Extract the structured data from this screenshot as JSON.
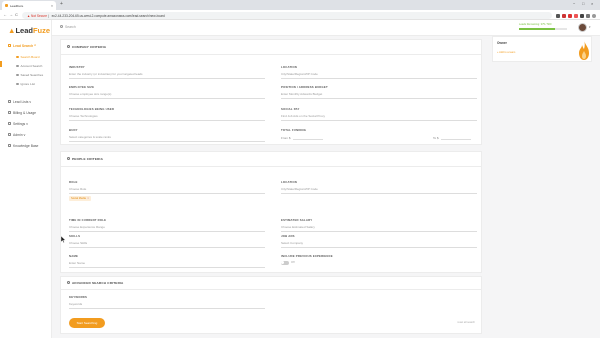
{
  "browser": {
    "tab_title": "LeadFuze",
    "new_tab": "+",
    "not_secure": "Not Secure",
    "url": "ec2-44-233-204-65.us-west-2.compute.amazonaws.com/lead-search/new-board",
    "nav": {
      "back": "←",
      "forward": "→",
      "reload": "C"
    },
    "window_controls": {
      "minimize": "−",
      "maximize": "□",
      "close": "×"
    }
  },
  "sidebar": {
    "logo": {
      "prefix": "Lead",
      "suffix": "Fuze"
    },
    "items": [
      {
        "label": "Lead Search",
        "caret": "^",
        "active": true
      },
      {
        "label": "Lead Lists",
        "caret": "v"
      },
      {
        "label": "Billing & Usage"
      },
      {
        "label": "Settings",
        "caret": "v"
      },
      {
        "label": "Admin",
        "caret": "v"
      },
      {
        "label": "Knowledge Base"
      }
    ],
    "sub_items": [
      {
        "label": "Search Board",
        "active": true
      },
      {
        "label": "Account Search"
      },
      {
        "label": "Saved Searches"
      },
      {
        "label": "Ignore List"
      }
    ]
  },
  "header": {
    "search_placeholder": "Search",
    "credits_label": "Leads Remaining: 375 / 500",
    "credits_fraction": 0.75
  },
  "company_card": {
    "title": "COMPANY CRITERIA",
    "fields": [
      {
        "label": "INDUSTRY",
        "placeholder": "Enter the industry (or industries) for your targeted leads"
      },
      {
        "label": "LOCATION",
        "placeholder": "City/State/Region/ZIP Code"
      },
      {
        "label": "EMPLOYEE SIZE",
        "placeholder": "Choose employee size range(s)"
      },
      {
        "label": "POSITION / ADDRESS BUDGET",
        "placeholder": "Enter Monthly Adwords Budget"
      },
      {
        "label": "TECHNOLOGIES BEING USED",
        "placeholder": "Choose Technologies"
      },
      {
        "label": "SOCIAL PAY",
        "placeholder": "Find Job Ads on the Social Proxy"
      },
      {
        "label": "BUDY",
        "placeholder": "Select categories & scale ranks"
      },
      {
        "label": "TOTAL FUNDING",
        "placeholder": ""
      }
    ],
    "funding_from": "From $",
    "funding_to": "To $"
  },
  "people_card": {
    "title": "PEOPLE CRITERIA",
    "fields": [
      {
        "label": "ROLE",
        "placeholder": "Choose Role"
      },
      {
        "label": "LOCATION",
        "placeholder": "City/State/Region/ZIP Code"
      },
      {
        "label": "TIME IN CURRENT ROLE",
        "placeholder": "Choose Experience Range"
      },
      {
        "label": "ESTIMATED SALARY",
        "placeholder": "Choose Estimated Salary"
      },
      {
        "label": "SKILLS",
        "placeholder": "Choose Skills"
      },
      {
        "label": "JOB ADS",
        "placeholder": "Select Company"
      },
      {
        "label": "NAME",
        "placeholder": "Enter Name"
      },
      {
        "label": "INCLUDE PREVIOUS EXPERIENCE",
        "placeholder": ""
      }
    ],
    "role_tag": "Social Media",
    "role_tag_remove": "×",
    "toggle_label": "Off"
  },
  "advanced_card": {
    "title": "ADVANCED SEARCH CRITERIA",
    "keywords_label": "KEYWORDS",
    "keywords_placeholder": "Keywords",
    "search_button": "Start Searching",
    "reset_link": "reset all search"
  },
  "right_panel": {
    "title": "Owner",
    "link": "+ Add to a team"
  },
  "colors": {
    "accent": "#f29c1f",
    "credit_green": "#7ac142"
  }
}
